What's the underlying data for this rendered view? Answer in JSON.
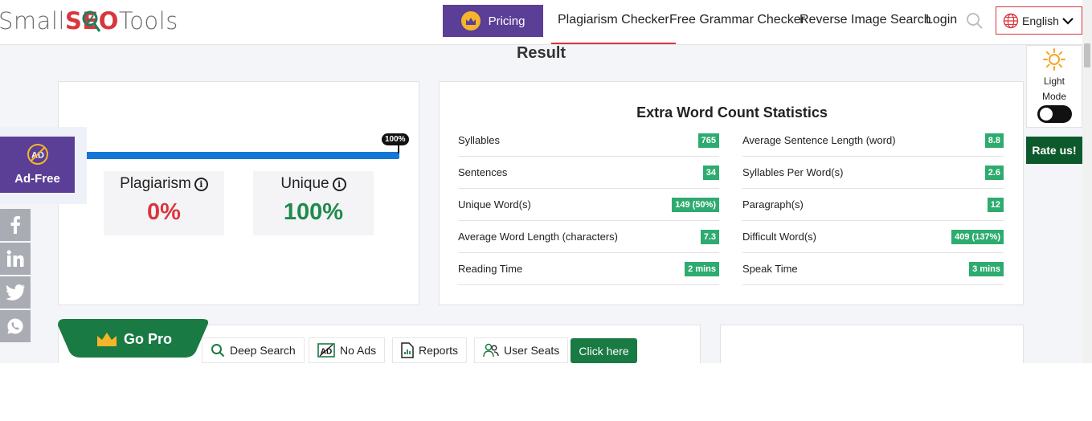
{
  "header": {
    "logo_parts": [
      "Small",
      "SEO",
      "Tools"
    ],
    "pricing_label": "Pricing",
    "nav": [
      {
        "label": "Plagiarism Checker",
        "active": true
      },
      {
        "label": "Free Grammar Checker",
        "active": false
      },
      {
        "label": "Reverse Image Search",
        "active": false
      },
      {
        "label": "Login",
        "active": false
      }
    ],
    "language": "English"
  },
  "result": {
    "title": "Result",
    "progress_label": "100%",
    "progress_value": 1.0,
    "plagiarism": {
      "label": "Plagiarism",
      "value": "0%"
    },
    "unique": {
      "label": "Unique",
      "value": "100%"
    }
  },
  "stats": {
    "title": "Extra Word Count Statistics",
    "left": [
      {
        "label": "Syllables",
        "value": "765"
      },
      {
        "label": "Sentences",
        "value": "34"
      },
      {
        "label": "Unique Word(s)",
        "value": "149 (50%)"
      },
      {
        "label": "Average Word Length (characters)",
        "value": "7.3"
      },
      {
        "label": "Reading Time",
        "value": "2 mins"
      }
    ],
    "right": [
      {
        "label": "Average Sentence Length (word)",
        "value": "8.8"
      },
      {
        "label": "Syllables Per Word(s)",
        "value": "2.6"
      },
      {
        "label": "Paragraph(s)",
        "value": "12"
      },
      {
        "label": "Difficult Word(s)",
        "value": "409 (137%)"
      },
      {
        "label": "Speak Time",
        "value": "3 mins"
      }
    ]
  },
  "widgets": {
    "mode_line1": "Light",
    "mode_line2": "Mode",
    "rate_label": "Rate us!",
    "adfree_label": "Ad-Free",
    "ad_icon_text": "AD"
  },
  "gopro": {
    "label": "Go Pro",
    "features": [
      "Deep Search",
      "No Ads",
      "Reports",
      "User Seats"
    ],
    "no_ads_icon_text": "AD",
    "cta": "Click here"
  },
  "colors": {
    "accent_red": "#d9363e",
    "purple": "#5b3e96",
    "green_badge": "#2eab6f",
    "plagiarism_red": "#d9363e",
    "unique_green": "#1e8a4c",
    "progress_blue": "#1476d6"
  }
}
